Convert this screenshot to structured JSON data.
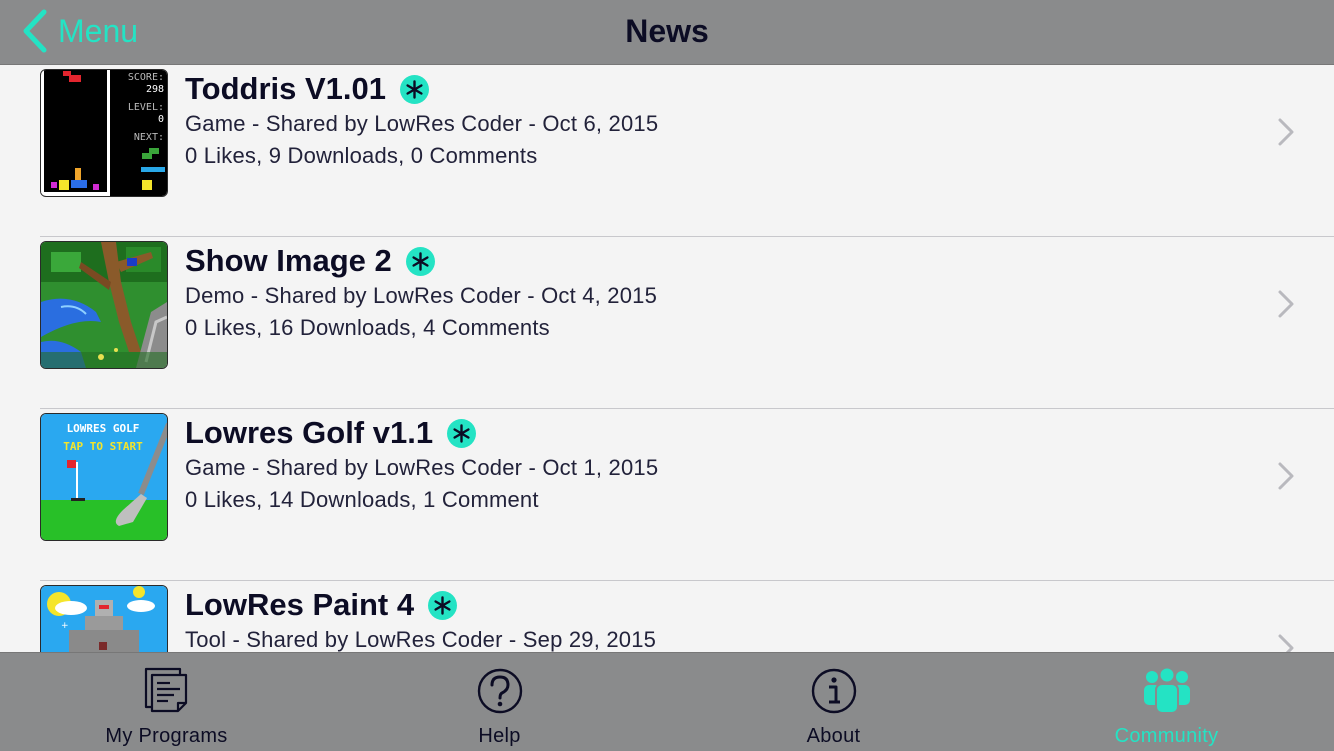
{
  "nav": {
    "back_label": "Menu",
    "title": "News"
  },
  "colors": {
    "accent": "#24e3c4",
    "bars": "#8a8b8c",
    "background": "#f4f4f4"
  },
  "items": [
    {
      "title": "Toddris V1.01",
      "subtitle": "Game - Shared by LowRes Coder - Oct 6, 2015",
      "stats": "0 Likes, 9 Downloads, 0 Comments",
      "thumb_text": [
        "SCORE:",
        "298",
        "LEVEL:",
        "0",
        "NEXT:"
      ]
    },
    {
      "title": "Show Image 2",
      "subtitle": "Demo - Shared by LowRes Coder - Oct 4, 2015",
      "stats": "0 Likes, 16 Downloads, 4 Comments"
    },
    {
      "title": "Lowres Golf v1.1",
      "subtitle": "Game - Shared by LowRes Coder - Oct 1, 2015",
      "stats": "0 Likes, 14 Downloads, 1 Comment",
      "thumb_text": [
        "LOWRES GOLF",
        "TAP TO START"
      ]
    },
    {
      "title": "LowRes Paint 4",
      "subtitle": "Tool - Shared by LowRes Coder - Sep 29, 2015",
      "stats": ""
    }
  ],
  "tabs": [
    {
      "label": "My Programs",
      "icon": "document-icon",
      "active": false
    },
    {
      "label": "Help",
      "icon": "question-icon",
      "active": false
    },
    {
      "label": "About",
      "icon": "info-icon",
      "active": false
    },
    {
      "label": "Community",
      "icon": "people-icon",
      "active": true
    }
  ]
}
